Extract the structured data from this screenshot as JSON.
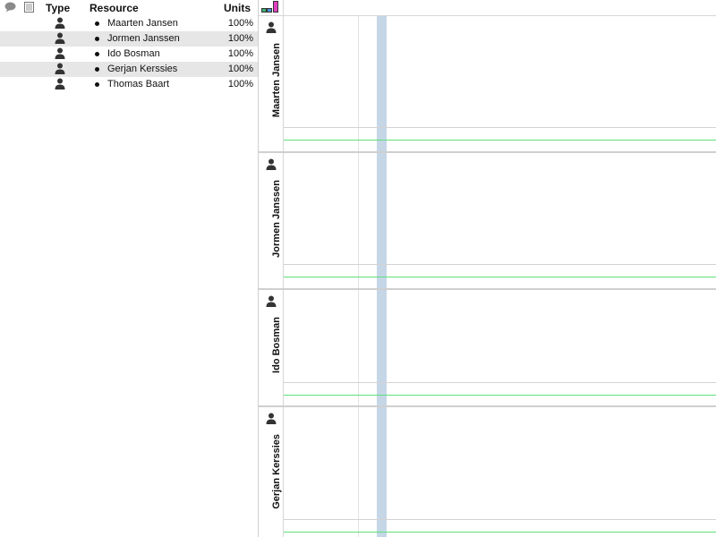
{
  "table": {
    "headers": {
      "type": "Type",
      "resource": "Resource",
      "units": "Units"
    },
    "header_icons": [
      "comment-icon",
      "notes-icon"
    ],
    "rows": [
      {
        "type_icon": "person-icon",
        "name": "Maarten Jansen",
        "units": "100%",
        "selected": false
      },
      {
        "type_icon": "person-icon",
        "name": "Jormen Janssen",
        "units": "100%",
        "selected": true
      },
      {
        "type_icon": "person-icon",
        "name": "Ido Bosman",
        "units": "100%",
        "selected": false
      },
      {
        "type_icon": "person-icon",
        "name": "Gerjan Kerssies",
        "units": "100%",
        "selected": true
      },
      {
        "type_icon": "person-icon",
        "name": "Thomas Baart",
        "units": "100%",
        "selected": false
      }
    ]
  },
  "chart": {
    "legend_icon": "bar-chart-legend-icon",
    "colors": {
      "today_column": "#c5d6e7",
      "capacity_line": "#5ee07a",
      "grid": "#e2e2e2"
    },
    "lanes": [
      {
        "name": "Maarten Jansen",
        "icon": "person-icon"
      },
      {
        "name": "Jormen Janssen",
        "icon": "person-icon"
      },
      {
        "name": "Ido Bosman",
        "icon": "person-icon"
      },
      {
        "name": "Gerjan Kerssies",
        "icon": "person-icon"
      }
    ]
  }
}
